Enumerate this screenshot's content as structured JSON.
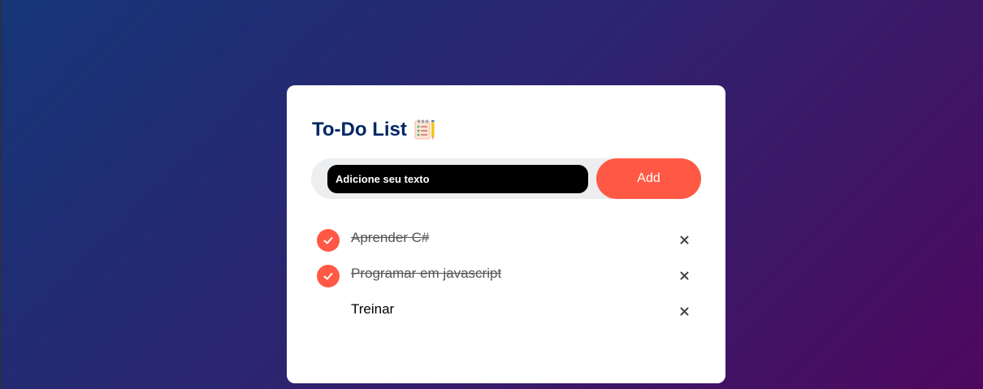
{
  "app": {
    "title": "To-Do List"
  },
  "input": {
    "placeholder": "Adicione seu texto",
    "value": ""
  },
  "add_button": {
    "label": "Add"
  },
  "tasks": [
    {
      "text": "Aprender C#",
      "checked": true
    },
    {
      "text": "Programar em javascript",
      "checked": true
    },
    {
      "text": "Treinar",
      "checked": false
    }
  ],
  "colors": {
    "accent": "#ff5945",
    "title": "#002765",
    "gradient_start": "#153677",
    "gradient_end": "#4e085f"
  },
  "icons": {
    "title": "notepad-icon",
    "check": "check-icon",
    "delete": "close-icon"
  }
}
